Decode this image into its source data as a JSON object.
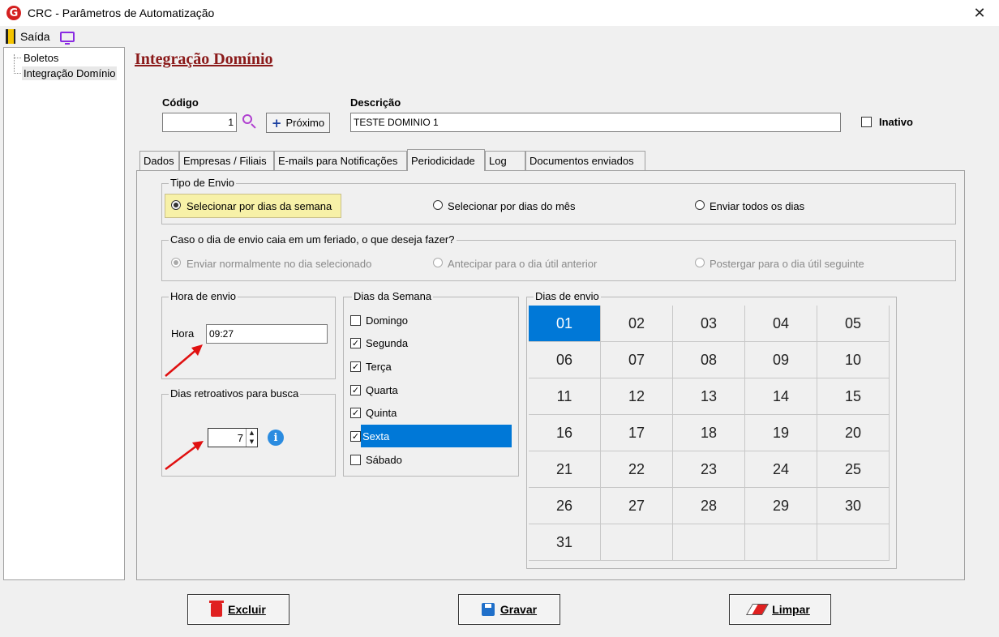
{
  "window": {
    "title": "CRC - Parâmetros de Automatização",
    "close_glyph": "✕",
    "logo_letter": "G"
  },
  "menu": {
    "exit_label": "Saída"
  },
  "sidebar": {
    "items": [
      {
        "label": "Boletos"
      },
      {
        "label": "Integração Domínio"
      }
    ]
  },
  "page_title": "Integração Domínio",
  "form": {
    "codigo_label": "Código",
    "codigo_value": "1",
    "proximo_label": "Próximo",
    "descricao_label": "Descrição",
    "descricao_value": "TESTE DOMINIO 1",
    "inativo_label": "Inativo",
    "inativo_checked": false
  },
  "tabs": [
    {
      "label": "Dados"
    },
    {
      "label": "Empresas / Filiais"
    },
    {
      "label": "E-mails para Notificações"
    },
    {
      "label": "Periodicidade",
      "active": true
    },
    {
      "label": "Log"
    },
    {
      "label": "Documentos enviados"
    }
  ],
  "tipo_envio": {
    "title": "Tipo de Envio",
    "options": [
      {
        "label": "Selecionar por dias da semana",
        "checked": true
      },
      {
        "label": "Selecionar por dias do mês",
        "checked": false
      },
      {
        "label": "Enviar todos os dias",
        "checked": false
      }
    ]
  },
  "feriado": {
    "title": "Caso o dia de envio caia em um feriado, o que deseja fazer?",
    "options": [
      {
        "label": "Enviar normalmente no dia selecionado",
        "checked": true
      },
      {
        "label": "Antecipar para o dia útil anterior",
        "checked": false
      },
      {
        "label": "Postergar para o dia útil seguinte",
        "checked": false
      }
    ]
  },
  "hora_envio": {
    "title": "Hora de envio",
    "label": "Hora",
    "value": "09:27"
  },
  "dias_retroativos": {
    "title": "Dias retroativos para busca",
    "value": "7",
    "info_glyph": "i"
  },
  "dias_semana": {
    "title": "Dias da Semana",
    "items": [
      {
        "label": "Domingo",
        "checked": false
      },
      {
        "label": "Segunda",
        "checked": true
      },
      {
        "label": "Terça",
        "checked": true
      },
      {
        "label": "Quarta",
        "checked": true
      },
      {
        "label": "Quinta",
        "checked": true
      },
      {
        "label": "Sexta",
        "checked": true,
        "selected": true
      },
      {
        "label": "Sábado",
        "checked": false
      }
    ]
  },
  "dias_envio": {
    "title": "Dias de envio",
    "days": [
      "01",
      "02",
      "03",
      "04",
      "05",
      "06",
      "07",
      "08",
      "09",
      "10",
      "11",
      "12",
      "13",
      "14",
      "15",
      "16",
      "17",
      "18",
      "19",
      "20",
      "21",
      "22",
      "23",
      "24",
      "25",
      "26",
      "27",
      "28",
      "29",
      "30",
      "31"
    ],
    "selected": "01"
  },
  "buttons": {
    "excluir_label": "Excluir",
    "gravar_label": "Gravar",
    "limpar_label": "Limpar"
  },
  "colors": {
    "selection": "#0078d7",
    "title_red": "#8b1a1a",
    "highlight_yellow": "#f7f1a8",
    "arrow_red": "#e01010"
  }
}
